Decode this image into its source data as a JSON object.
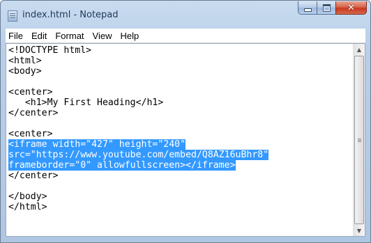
{
  "window": {
    "title": "index.html - Notepad",
    "caption": {
      "minimize": "minimize",
      "maximize": "maximize",
      "close": "✕"
    }
  },
  "menubar": {
    "items": [
      "File",
      "Edit",
      "Format",
      "View",
      "Help"
    ]
  },
  "editor": {
    "lines": [
      {
        "text": "<!DOCTYPE html>",
        "selected": false
      },
      {
        "text": "<html>",
        "selected": false
      },
      {
        "text": "<body>",
        "selected": false
      },
      {
        "text": "",
        "selected": false
      },
      {
        "text": "<center>",
        "selected": false
      },
      {
        "text": "   <h1>My First Heading</h1>",
        "selected": false
      },
      {
        "text": "</center>",
        "selected": false
      },
      {
        "text": "",
        "selected": false
      },
      {
        "text": "<center>",
        "selected": false
      },
      {
        "text": "<iframe width=\"427\" height=\"240\"",
        "selected": true
      },
      {
        "text": "src=\"https://www.youtube.com/embed/Q8AZ16uBhr8\"",
        "selected": true
      },
      {
        "text": "frameborder=\"0\" allowfullscreen></iframe>",
        "selected": true
      },
      {
        "text": "</center>",
        "selected": false
      },
      {
        "text": "",
        "selected": false
      },
      {
        "text": "</body>",
        "selected": false
      },
      {
        "text": "</html>",
        "selected": false
      }
    ]
  },
  "scrollbar": {
    "up_icon": "▲",
    "down_icon": "▼"
  }
}
